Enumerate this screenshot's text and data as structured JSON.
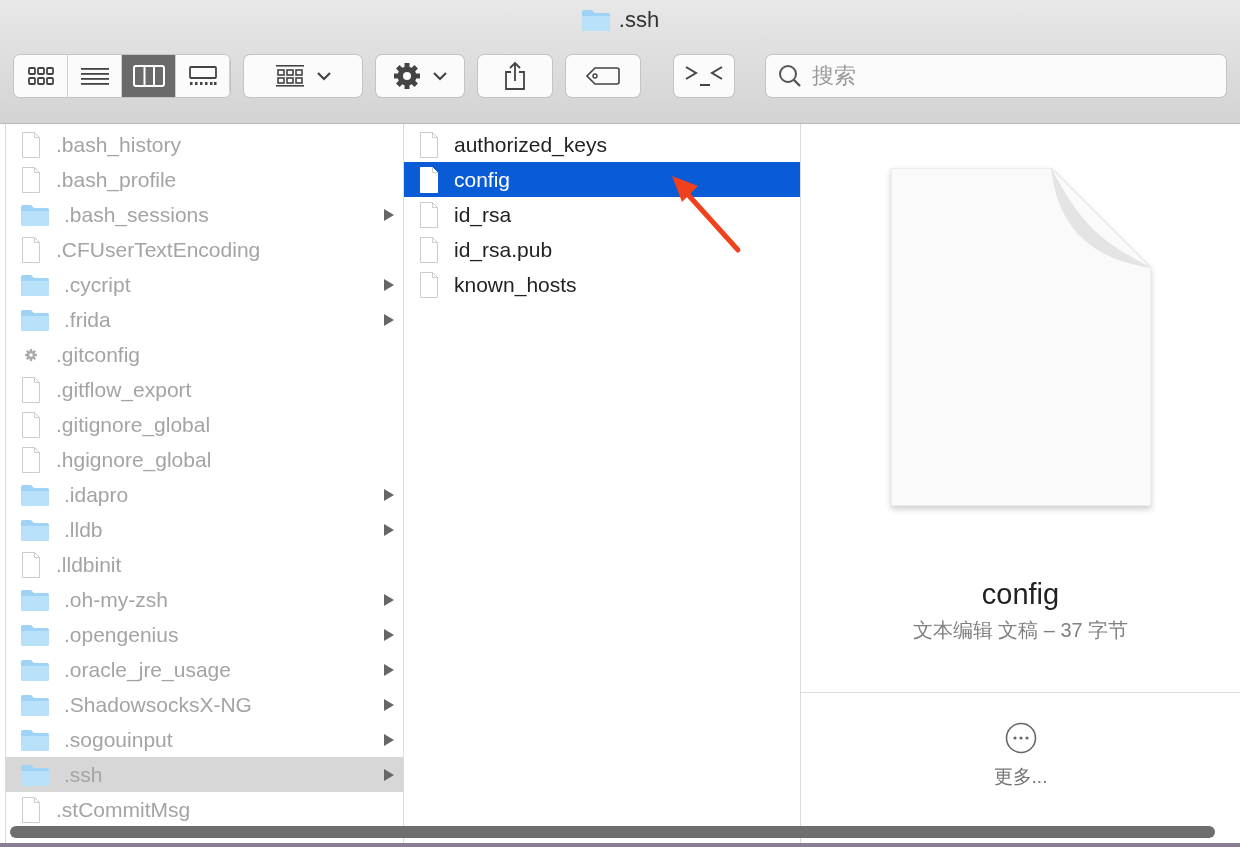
{
  "window": {
    "title": ".ssh"
  },
  "toolbar": {
    "view_modes": [
      {
        "kind": "icons",
        "selected": false
      },
      {
        "kind": "list",
        "selected": false
      },
      {
        "kind": "columns",
        "selected": true
      },
      {
        "kind": "gallery",
        "selected": false
      }
    ],
    "search": {
      "placeholder": "搜索"
    }
  },
  "columns": [
    {
      "items": [
        {
          "name": ".bash_history",
          "kind": "file",
          "dimmed": true,
          "selected": false
        },
        {
          "name": ".bash_profile",
          "kind": "file",
          "dimmed": true,
          "selected": false
        },
        {
          "name": ".bash_sessions",
          "kind": "folder",
          "dimmed": true,
          "selected": false
        },
        {
          "name": ".CFUserTextEncoding",
          "kind": "file",
          "dimmed": true,
          "selected": false
        },
        {
          "name": ".cycript",
          "kind": "folder",
          "dimmed": true,
          "selected": false
        },
        {
          "name": ".frida",
          "kind": "folder",
          "dimmed": true,
          "selected": false
        },
        {
          "name": ".gitconfig",
          "kind": "gear",
          "dimmed": true,
          "selected": false
        },
        {
          "name": ".gitflow_export",
          "kind": "file",
          "dimmed": true,
          "selected": false
        },
        {
          "name": ".gitignore_global",
          "kind": "file",
          "dimmed": true,
          "selected": false
        },
        {
          "name": ".hgignore_global",
          "kind": "file",
          "dimmed": true,
          "selected": false
        },
        {
          "name": ".idapro",
          "kind": "folder",
          "dimmed": true,
          "selected": false
        },
        {
          "name": ".lldb",
          "kind": "folder",
          "dimmed": true,
          "selected": false
        },
        {
          "name": ".lldbinit",
          "kind": "file",
          "dimmed": true,
          "selected": false
        },
        {
          "name": ".oh-my-zsh",
          "kind": "folder",
          "dimmed": true,
          "selected": false
        },
        {
          "name": ".opengenius",
          "kind": "folder",
          "dimmed": true,
          "selected": false
        },
        {
          "name": ".oracle_jre_usage",
          "kind": "folder",
          "dimmed": true,
          "selected": false
        },
        {
          "name": ".ShadowsocksX-NG",
          "kind": "folder",
          "dimmed": true,
          "selected": false
        },
        {
          "name": ".sogouinput",
          "kind": "folder",
          "dimmed": true,
          "selected": false
        },
        {
          "name": ".ssh",
          "kind": "folder",
          "dimmed": true,
          "selected": true
        },
        {
          "name": ".stCommitMsg",
          "kind": "file",
          "dimmed": true,
          "selected": false
        }
      ]
    },
    {
      "items": [
        {
          "name": "authorized_keys",
          "kind": "file",
          "dimmed": false,
          "selected": false
        },
        {
          "name": "config",
          "kind": "file",
          "dimmed": false,
          "selected": true
        },
        {
          "name": "id_rsa",
          "kind": "file",
          "dimmed": false,
          "selected": false
        },
        {
          "name": "id_rsa.pub",
          "kind": "file",
          "dimmed": false,
          "selected": false
        },
        {
          "name": "known_hosts",
          "kind": "file",
          "dimmed": false,
          "selected": false
        }
      ]
    }
  ],
  "preview": {
    "name": "config",
    "info": "文本编辑 文稿 – 37 字节",
    "more": "更多..."
  }
}
